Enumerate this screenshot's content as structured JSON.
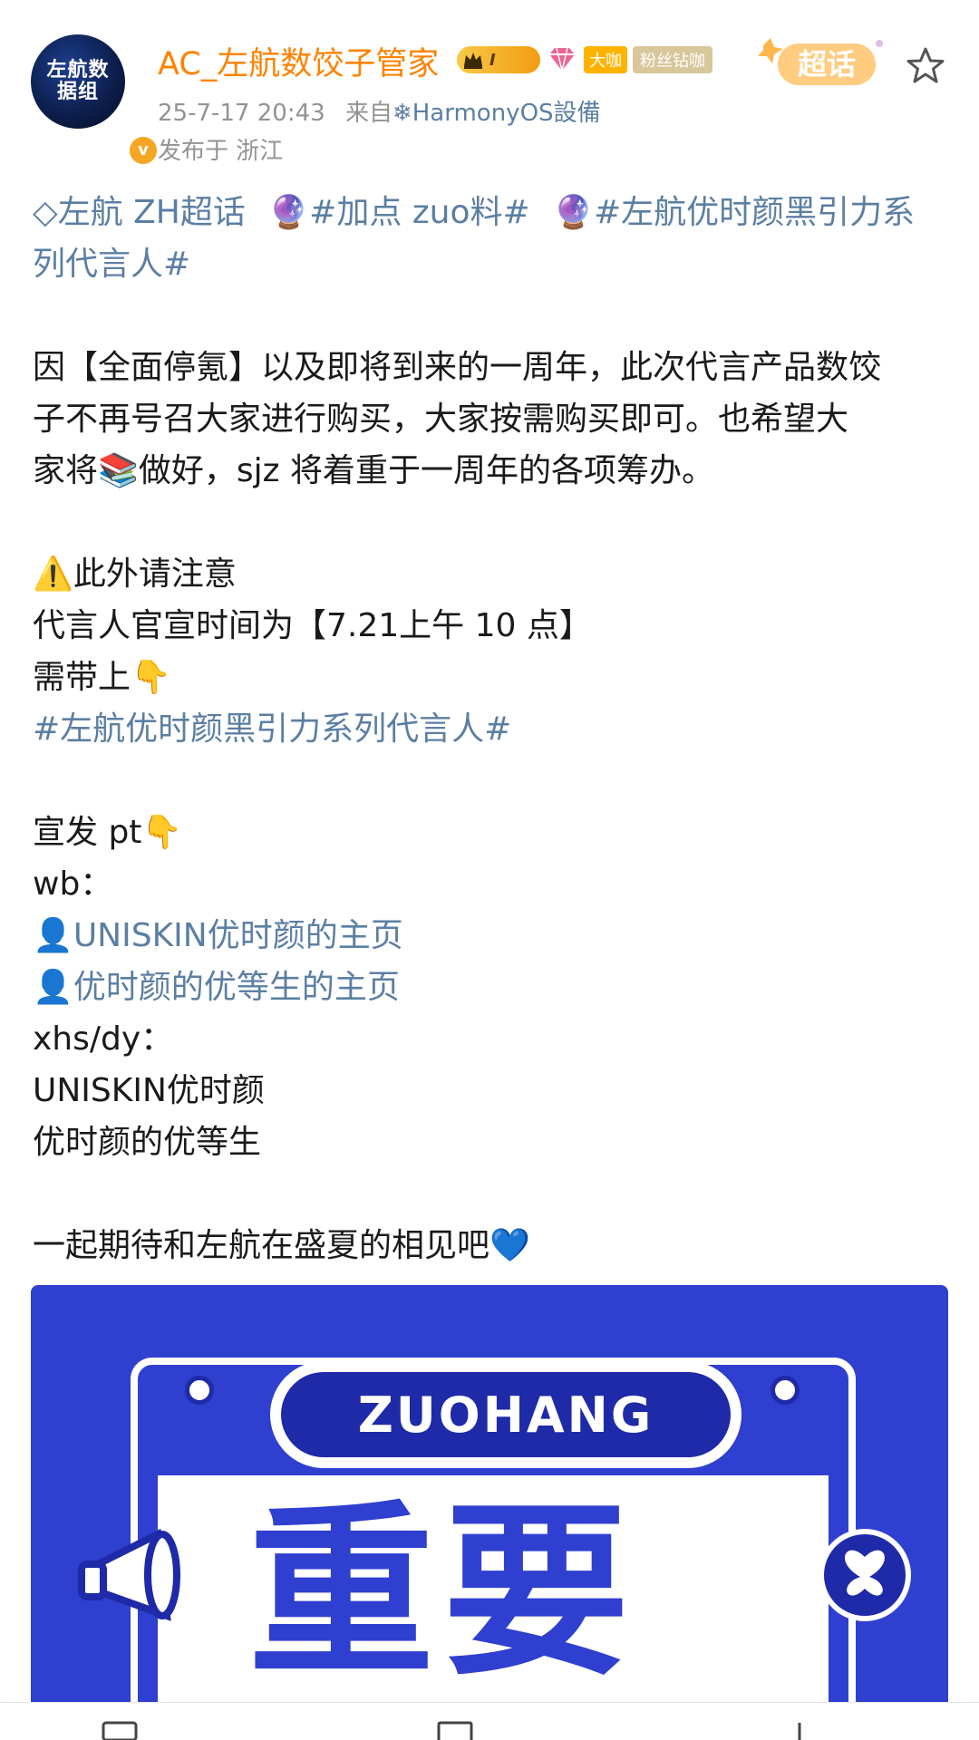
{
  "post": {
    "username": "AC_左航数饺子管家",
    "avatar_text": "左航数据组",
    "level": "I",
    "tag_da": "大咖",
    "tag_fans": "粉丝钻咖",
    "timestamp": "25-7-17 20:43",
    "source_prefix": "来自",
    "source_device": "HarmonyOS設備",
    "location": "发布于 浙江",
    "chaohua_label": "超话"
  },
  "content": {
    "topic_supertopic": "左航 ZH超话",
    "topic_1": "#加点 zuo料#",
    "topic_2_part1": "#左航优时颜黑引力系",
    "topic_2_part2": "列代言人#",
    "para1_line1": "因【全面停氪】以及即将到来的一周年，此次代言产品数饺",
    "para1_line2": "子不再号召大家进行购买，大家按需购买即可。也希望大",
    "para1_line3_a": "家将",
    "para1_line3_b": "做好，sjz 将着重于一周年的各项筹办。",
    "notice_title": "此外请注意",
    "notice_time": "代言人官宣时间为【7.21上午 10 点】",
    "notice_bring": "需带上",
    "notice_topic": "#左航优时颜黑引力系列代言人#",
    "pt_title": "宣发 pt",
    "wb_label": "wb：",
    "wb_link_1": "UNISKIN优时颜的主页",
    "wb_link_2": "优时颜的优等生的主页",
    "xhs_label": "xhs/dy：",
    "xhs_1": "UNISKIN优时颜",
    "xhs_2": "优时颜的优等生",
    "closing": "一起期待和左航在盛夏的相见吧"
  },
  "promo": {
    "pill_text": "ZUOHANG",
    "big_text": "重要"
  },
  "colors": {
    "username": "#ff8200",
    "link": "#5b7fa3",
    "meta": "#939393",
    "promo_blue": "#2f3fd0"
  }
}
